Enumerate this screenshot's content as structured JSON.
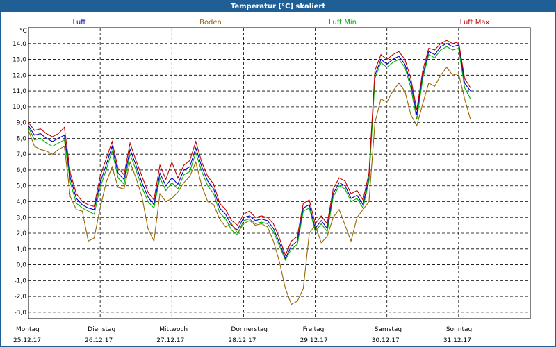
{
  "window": {
    "title": "Temperatur [°C] skaliert"
  },
  "chart_data": {
    "type": "line",
    "title": "Temperatur [°C] skaliert",
    "ylabel": "°C",
    "ylim": [
      -3.4,
      15.0
    ],
    "yticks": [
      -3.0,
      -2.0,
      -1.0,
      0.0,
      1.0,
      2.0,
      3.0,
      4.0,
      5.0,
      6.0,
      7.0,
      8.0,
      9.0,
      10.0,
      11.0,
      12.0,
      13.0,
      14.0
    ],
    "ytick_labels": [
      "-3,0",
      "-2,0",
      "-1,0",
      "0,0",
      "1,0",
      "2,0",
      "3,0",
      "4,0",
      "5,0",
      "6,0",
      "7,0",
      "8,0",
      "9,0",
      "10,0",
      "11,0",
      "12,0",
      "13,0",
      "14,0"
    ],
    "x_days": [
      {
        "weekday": "Montag",
        "date": "25.12.17"
      },
      {
        "weekday": "Dienstag",
        "date": "26.12.17"
      },
      {
        "weekday": "Mittwoch",
        "date": "27.12.17"
      },
      {
        "weekday": "Donnerstag",
        "date": "28.12.17"
      },
      {
        "weekday": "Freitag",
        "date": "29.12.17"
      },
      {
        "weekday": "Samstag",
        "date": "30.12.17"
      },
      {
        "weekday": "Sonntag",
        "date": "31.12.17"
      }
    ],
    "grid": true,
    "legend_position": "top",
    "x_hours": [
      0,
      2,
      4,
      6,
      8,
      10,
      12,
      14,
      16,
      18,
      20,
      22,
      24,
      26,
      28,
      30,
      32,
      34,
      36,
      38,
      40,
      42,
      44,
      46,
      48,
      50,
      52,
      54,
      56,
      58,
      60,
      62,
      64,
      66,
      68,
      70,
      72,
      74,
      76,
      78,
      80,
      82,
      84,
      86,
      88,
      90,
      92,
      94,
      96,
      98,
      100,
      102,
      104,
      106,
      108,
      110,
      112,
      114,
      116,
      118,
      120,
      122,
      124,
      126,
      128,
      130,
      132,
      134,
      136,
      138,
      140,
      142,
      144,
      146,
      148,
      150,
      152,
      154,
      156,
      158,
      160,
      162,
      164,
      166,
      168
    ],
    "series": [
      {
        "name": "Luft",
        "color": "#0000c0",
        "values": [
          8.8,
          8.2,
          8.3,
          8.0,
          7.8,
          8.0,
          8.2,
          5.5,
          4.2,
          3.8,
          3.6,
          3.5,
          5.2,
          6.3,
          7.5,
          5.8,
          5.4,
          7.3,
          6.3,
          5.2,
          4.3,
          3.8,
          5.8,
          5.0,
          5.5,
          5.1,
          6.0,
          6.2,
          7.4,
          6.2,
          5.3,
          4.8,
          3.6,
          3.2,
          2.5,
          2.2,
          3.0,
          3.1,
          2.8,
          2.9,
          2.8,
          2.3,
          1.4,
          0.4,
          1.2,
          1.5,
          3.6,
          3.8,
          2.3,
          2.8,
          2.3,
          4.5,
          5.2,
          5.0,
          4.2,
          4.4,
          3.8,
          5.5,
          12.0,
          13.0,
          12.7,
          13.0,
          13.2,
          12.7,
          11.5,
          9.5,
          12.0,
          13.5,
          13.3,
          13.8,
          14.0,
          13.8,
          13.9,
          11.5,
          11.0
        ]
      },
      {
        "name": "Boden",
        "color": "#996600",
        "values": [
          8.5,
          7.5,
          7.3,
          7.2,
          7.0,
          7.3,
          7.5,
          4.3,
          3.5,
          3.4,
          1.5,
          1.7,
          3.6,
          5.2,
          6.2,
          4.9,
          4.8,
          6.5,
          5.5,
          4.3,
          2.3,
          1.5,
          4.5,
          4.0,
          4.2,
          4.6,
          5.2,
          5.6,
          6.5,
          5.0,
          4.0,
          3.8,
          2.9,
          2.4,
          2.6,
          2.0,
          2.6,
          2.8,
          2.5,
          2.6,
          2.4,
          1.5,
          0.2,
          -1.5,
          -2.5,
          -2.3,
          -1.5,
          2.0,
          2.5,
          1.4,
          1.8,
          3.0,
          3.5,
          2.5,
          1.5,
          3.0,
          3.5,
          4.0,
          9.0,
          10.5,
          10.3,
          11.0,
          11.5,
          11.0,
          9.5,
          8.8,
          10.2,
          11.5,
          11.3,
          12.0,
          12.5,
          12.0,
          12.1,
          10.5,
          9.2
        ]
      },
      {
        "name": "Luft Min",
        "color": "#00b000",
        "values": [
          8.7,
          7.9,
          8.0,
          7.7,
          7.5,
          7.7,
          7.9,
          5.2,
          3.9,
          3.6,
          3.4,
          3.2,
          4.9,
          6.0,
          7.2,
          5.5,
          5.1,
          7.0,
          6.0,
          4.9,
          4.0,
          3.6,
          5.5,
          4.7,
          5.2,
          4.8,
          5.7,
          5.9,
          7.1,
          5.9,
          5.0,
          4.5,
          3.3,
          2.9,
          2.2,
          1.9,
          2.8,
          2.9,
          2.6,
          2.7,
          2.6,
          2.1,
          1.2,
          0.3,
          1.0,
          1.3,
          3.4,
          3.6,
          2.1,
          2.6,
          2.1,
          4.3,
          5.0,
          4.8,
          4.0,
          4.2,
          3.6,
          5.3,
          11.8,
          12.8,
          12.5,
          12.8,
          13.0,
          12.5,
          11.2,
          9.2,
          11.8,
          13.3,
          13.1,
          13.6,
          13.8,
          13.6,
          13.7,
          11.2,
          10.5
        ]
      },
      {
        "name": "Luft Max",
        "color": "#c00000",
        "values": [
          9.0,
          8.5,
          8.6,
          8.3,
          8.1,
          8.3,
          8.7,
          5.8,
          4.5,
          4.0,
          3.8,
          3.7,
          5.6,
          6.7,
          7.8,
          6.1,
          5.7,
          7.7,
          6.6,
          5.6,
          4.6,
          4.1,
          6.3,
          5.4,
          6.5,
          5.5,
          6.3,
          6.6,
          7.8,
          6.5,
          5.6,
          5.1,
          3.9,
          3.5,
          2.8,
          2.5,
          3.2,
          3.4,
          3.0,
          3.1,
          3.0,
          2.6,
          1.7,
          0.6,
          1.5,
          1.8,
          3.9,
          4.1,
          2.6,
          3.1,
          2.6,
          4.8,
          5.5,
          5.3,
          4.5,
          4.7,
          4.1,
          5.8,
          12.3,
          13.3,
          13.0,
          13.3,
          13.5,
          13.0,
          11.8,
          9.8,
          12.3,
          13.7,
          13.6,
          14.0,
          14.2,
          14.0,
          14.1,
          11.8,
          11.2
        ]
      }
    ]
  }
}
